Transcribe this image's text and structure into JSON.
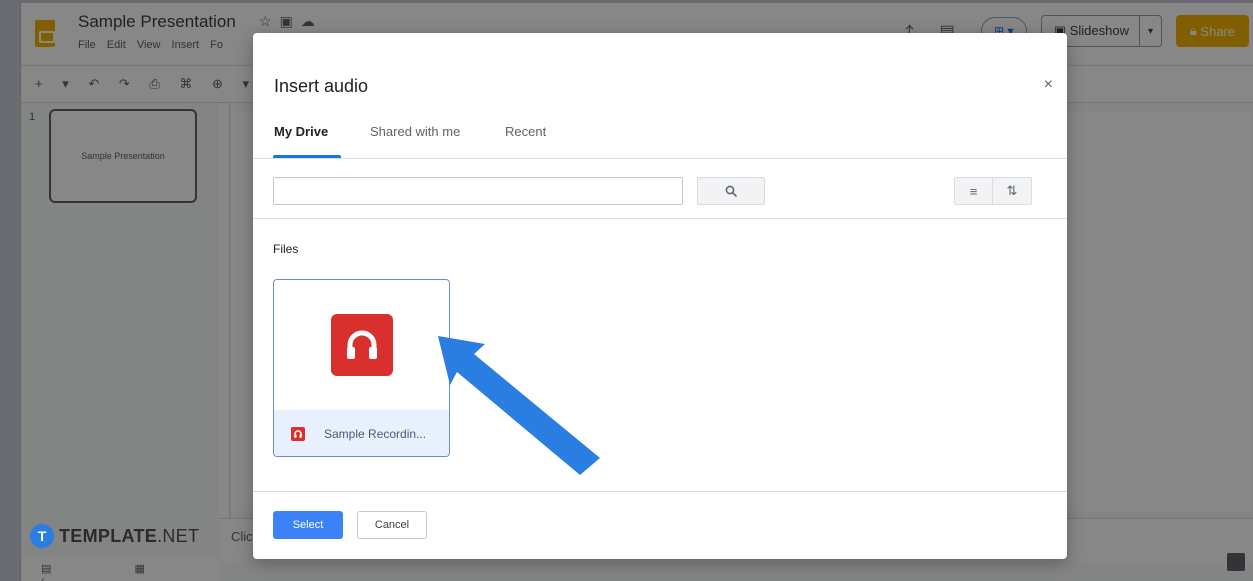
{
  "app": {
    "title": "Sample Presentation",
    "menu": [
      "File",
      "Edit",
      "View",
      "Insert",
      "Fo"
    ],
    "slideshow_label": "Slideshow",
    "share_label": "Share",
    "slide_number": "1",
    "slide_thumb_text": "Sample Presentation",
    "notes_text": "Clic"
  },
  "watermark": {
    "brand_main": "TEMPLATE",
    "brand_suffix": ".NET"
  },
  "dialog": {
    "title": "Insert audio",
    "tabs": [
      {
        "label": "My Drive",
        "active": true
      },
      {
        "label": "Shared with me",
        "active": false
      },
      {
        "label": "Recent",
        "active": false
      }
    ],
    "search": {
      "value": "",
      "placeholder": ""
    },
    "section_label": "Files",
    "files": [
      {
        "name": "Sample Recordin...",
        "type": "audio",
        "selected": true
      }
    ],
    "select_label": "Select",
    "cancel_label": "Cancel"
  },
  "colors": {
    "accent": "#1a73e8",
    "audio_icon": "#d9302e",
    "select_button": "#3b82f6",
    "arrow": "#2a7de1",
    "share": "#f4b400"
  },
  "icons": [
    "slides-logo-icon",
    "star-icon",
    "folder-icon",
    "cloud-icon",
    "close-icon",
    "search-icon",
    "list-view-icon",
    "sort-icon",
    "headphones-icon",
    "annotation-arrow-icon"
  ]
}
